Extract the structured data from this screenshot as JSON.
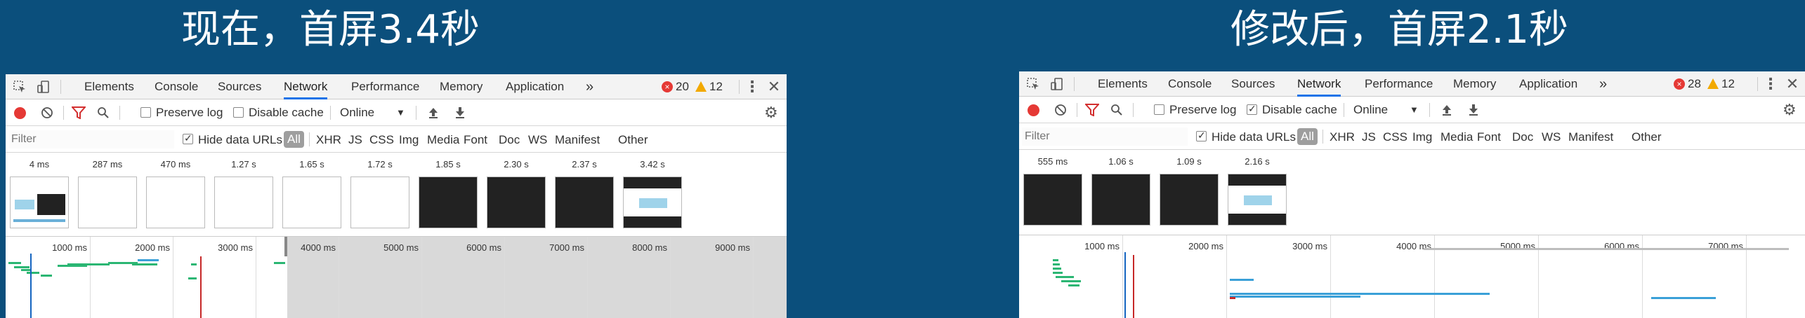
{
  "left": {
    "heading": "现在，首屏3.4秒",
    "tabs": [
      "Elements",
      "Console",
      "Sources",
      "Network",
      "Performance",
      "Memory",
      "Application"
    ],
    "active_tab": "Network",
    "more_tabs": "»",
    "errors": "20",
    "warnings": "12",
    "toolbar": {
      "preserve_log": "Preserve log",
      "preserve_log_checked": false,
      "disable_cache": "Disable cache",
      "disable_cache_checked": false,
      "throttle": "Online"
    },
    "filter": {
      "placeholder": "Filter",
      "hide_data_urls": "Hide data URLs",
      "all": "All",
      "types": [
        "XHR",
        "JS",
        "CSS",
        "Img",
        "Media",
        "Font",
        "Doc",
        "WS",
        "Manifest",
        "Other"
      ]
    },
    "frames": [
      {
        "time": "4 ms",
        "kind": "page"
      },
      {
        "time": "287 ms",
        "kind": "blank"
      },
      {
        "time": "470 ms",
        "kind": "blank"
      },
      {
        "time": "1.27 s",
        "kind": "blank"
      },
      {
        "time": "1.65 s",
        "kind": "blank"
      },
      {
        "time": "1.72 s",
        "kind": "blank"
      },
      {
        "time": "1.85 s",
        "kind": "dark"
      },
      {
        "time": "2.30 s",
        "kind": "dark"
      },
      {
        "time": "2.37 s",
        "kind": "dark"
      },
      {
        "time": "3.42 s",
        "kind": "final"
      }
    ],
    "overview_ticks": [
      "1000 ms",
      "2000 ms",
      "3000 ms",
      "4000 ms",
      "5000 ms",
      "6000 ms",
      "7000 ms",
      "8000 ms",
      "9000 ms"
    ]
  },
  "right": {
    "heading": "修改后，首屏2.1秒",
    "tabs": [
      "Elements",
      "Console",
      "Sources",
      "Network",
      "Performance",
      "Memory",
      "Application"
    ],
    "active_tab": "Network",
    "more_tabs": "»",
    "errors": "28",
    "warnings": "12",
    "toolbar": {
      "preserve_log": "Preserve log",
      "preserve_log_checked": false,
      "disable_cache": "Disable cache",
      "disable_cache_checked": true,
      "throttle": "Online"
    },
    "filter": {
      "placeholder": "Filter",
      "hide_data_urls": "Hide data URLs",
      "all": "All",
      "types": [
        "XHR",
        "JS",
        "CSS",
        "Img",
        "Media",
        "Font",
        "Doc",
        "WS",
        "Manifest",
        "Other"
      ]
    },
    "frames": [
      {
        "time": "555 ms",
        "kind": "dark"
      },
      {
        "time": "1.06 s",
        "kind": "dark"
      },
      {
        "time": "1.09 s",
        "kind": "dark"
      },
      {
        "time": "2.16 s",
        "kind": "final"
      }
    ],
    "overview_ticks": [
      "1000 ms",
      "2000 ms",
      "3000 ms",
      "4000 ms",
      "5000 ms",
      "6000 ms",
      "7000 ms"
    ]
  },
  "colors": {
    "background": "#0b4f7c",
    "accent": "#1a73e8",
    "record": "#e53935",
    "filter_icon": "#d32f2f",
    "waterfall_green": "#2bb673",
    "waterfall_blue": "#3aa0d8",
    "dom_content_line": "#1565c0",
    "load_line": "#c62828"
  }
}
